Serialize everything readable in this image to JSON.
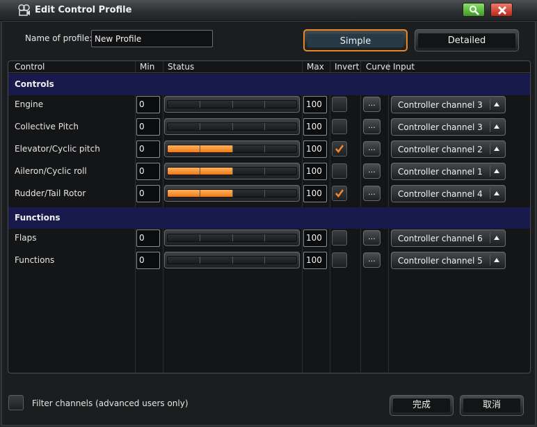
{
  "window": {
    "title": "Edit Control Profile"
  },
  "profile": {
    "name_label": "Name of profile:",
    "name_value": "New Profile"
  },
  "modes": {
    "simple": "Simple",
    "detailed": "Detailed",
    "selected": "Simple"
  },
  "columns": {
    "control": "Control",
    "min": "Min",
    "status": "Status",
    "max": "Max",
    "invert": "Invert",
    "curve": "Curve",
    "input": "Input"
  },
  "sections": {
    "controls": "Controls",
    "functions": "Functions"
  },
  "control_rows": [
    {
      "label": "Engine",
      "min": "0",
      "max": "100",
      "level": 0,
      "inverted": false,
      "curve": "...",
      "input": "Controller channel 3"
    },
    {
      "label": "Collective Pitch",
      "min": "0",
      "max": "100",
      "level": 0,
      "inverted": false,
      "curve": "...",
      "input": "Controller channel 3"
    },
    {
      "label": "Elevator/Cyclic pitch",
      "min": "0",
      "max": "100",
      "level": 0.5,
      "inverted": true,
      "curve": "...",
      "input": "Controller channel 2"
    },
    {
      "label": "Aileron/Cyclic roll",
      "min": "0",
      "max": "100",
      "level": 0.5,
      "inverted": false,
      "curve": "...",
      "input": "Controller channel 1"
    },
    {
      "label": "Rudder/Tail Rotor",
      "min": "0",
      "max": "100",
      "level": 0.5,
      "inverted": true,
      "curve": "...",
      "input": "Controller channel 4"
    }
  ],
  "function_rows": [
    {
      "label": "Flaps",
      "min": "0",
      "max": "100",
      "level": 0,
      "inverted": false,
      "curve": "...",
      "input": "Controller channel 6"
    },
    {
      "label": "Functions",
      "min": "0",
      "max": "100",
      "level": 0,
      "inverted": false,
      "curve": "...",
      "input": "Controller channel 5"
    }
  ],
  "footer": {
    "filter_label": "Filter channels (advanced users only)",
    "filter_checked": false,
    "ok": "完成",
    "cancel": "取消"
  },
  "colors": {
    "accent": "#e08a2c",
    "section_bg": "#171a4a",
    "fill": "#f07a10"
  },
  "icons": {
    "title": "camera-icon",
    "search": "search-icon",
    "close": "close-icon",
    "dropdown": "chevron-up-icon",
    "check": "checkmark-icon"
  }
}
